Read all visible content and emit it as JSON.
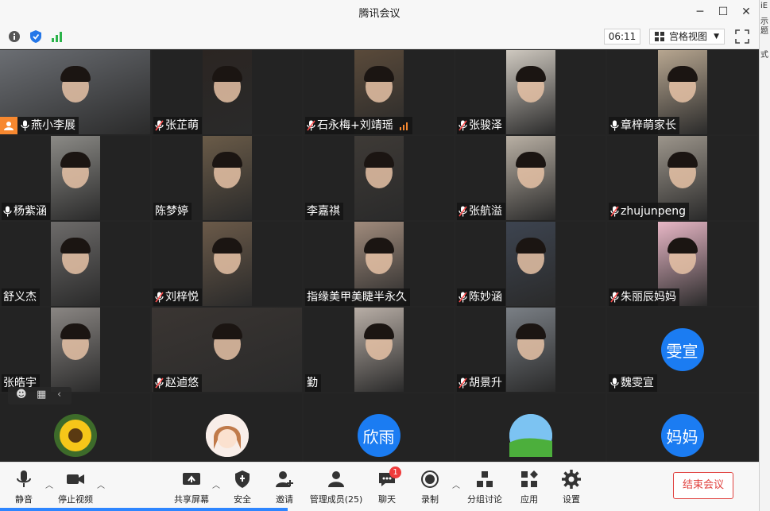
{
  "window": {
    "title": "腾讯会议"
  },
  "right_strip": [
    "iE",
    "示题",
    "式"
  ],
  "subbar": {
    "timer": "06:11",
    "view_label": "宫格视图"
  },
  "tiles": [
    {
      "name": "燕小李展",
      "host": true,
      "mic": "on",
      "video": true,
      "color": "#6b6e73"
    },
    {
      "name": "张芷萌",
      "mic": "muted",
      "video": true,
      "color": "#2b2522"
    },
    {
      "name": "石永梅+刘靖瑶",
      "mic": "muted",
      "video": true,
      "color": "#5a4a3a",
      "signal": true
    },
    {
      "name": "张骏泽",
      "mic": "muted",
      "video": true,
      "color": "#cfc9c0"
    },
    {
      "name": "章梓萌家长",
      "mic": "on",
      "video": true,
      "color": "#b7a690"
    },
    {
      "name": "杨紫涵",
      "mic": "on",
      "video": true,
      "color": "#8b8a86"
    },
    {
      "name": "陈梦婷",
      "mic": "none",
      "video": true,
      "color": "#6a5b48"
    },
    {
      "name": "李嘉祺",
      "mic": "none",
      "video": true,
      "color": "#3e3a36"
    },
    {
      "name": "张航溢",
      "mic": "muted",
      "video": true,
      "color": "#b9b0a4"
    },
    {
      "name": "zhujunpeng",
      "mic": "muted",
      "video": true,
      "color": "#9c958b"
    },
    {
      "name": "舒义杰",
      "mic": "none",
      "video": true,
      "color": "#6d6b6a"
    },
    {
      "name": "刘梓悦",
      "mic": "muted",
      "video": true,
      "color": "#6b5a49"
    },
    {
      "name": "指缘美甲美睫半永久",
      "mic": "none",
      "video": true,
      "color": "#a08b7c"
    },
    {
      "name": "陈妙涵",
      "mic": "muted",
      "video": true,
      "color": "#3d4450"
    },
    {
      "name": "朱丽辰妈妈",
      "mic": "muted",
      "video": true,
      "color": "#e8b7c6"
    },
    {
      "name": "张皓宇",
      "mic": "none",
      "video": true,
      "color": "#8a8683"
    },
    {
      "name": "赵逌悠",
      "mic": "muted",
      "video": true,
      "color": "#3a3532"
    },
    {
      "name": "勤",
      "mic": "none",
      "video": true,
      "color": "#b8aea6"
    },
    {
      "name": "胡景升",
      "mic": "muted",
      "video": true,
      "color": "#7a7f85"
    },
    {
      "name": "魏雯宣",
      "mic": "on",
      "video": false,
      "avatar_text": "雯宣",
      "avatar_color": "#1b7cf2"
    },
    {
      "name": "",
      "mic": "none",
      "video": false,
      "avatar_icon": "sunflower-avatar-icon",
      "avatar_color": "#f5c21b"
    },
    {
      "name": "",
      "mic": "none",
      "video": false,
      "avatar_icon": "cartoon-girl-avatar-icon",
      "avatar_color": "#f4e6e0"
    },
    {
      "name": "",
      "mic": "none",
      "video": false,
      "avatar_text": "欣雨",
      "avatar_color": "#1b7cf2"
    },
    {
      "name": "",
      "mic": "none",
      "video": false,
      "avatar_icon": "landscape-avatar-icon",
      "avatar_color": "#4aa3e8"
    },
    {
      "name": "",
      "mic": "none",
      "video": false,
      "avatar_text": "妈妈",
      "avatar_color": "#1b7cf2"
    }
  ],
  "toolbar": {
    "mute": "静音",
    "stop_video": "停止视频",
    "share_screen": "共享屏幕",
    "security": "安全",
    "invite": "邀请",
    "manage_members": "管理成员(25)",
    "chat": "聊天",
    "chat_badge": "1",
    "record": "录制",
    "breakout": "分组讨论",
    "apps": "应用",
    "settings": "设置",
    "end_meeting": "结束会议"
  },
  "colors": {
    "accent": "#1b7cf2",
    "end": "#e0413e",
    "host_badge": "#f7882f",
    "active_border": "#44c767"
  }
}
